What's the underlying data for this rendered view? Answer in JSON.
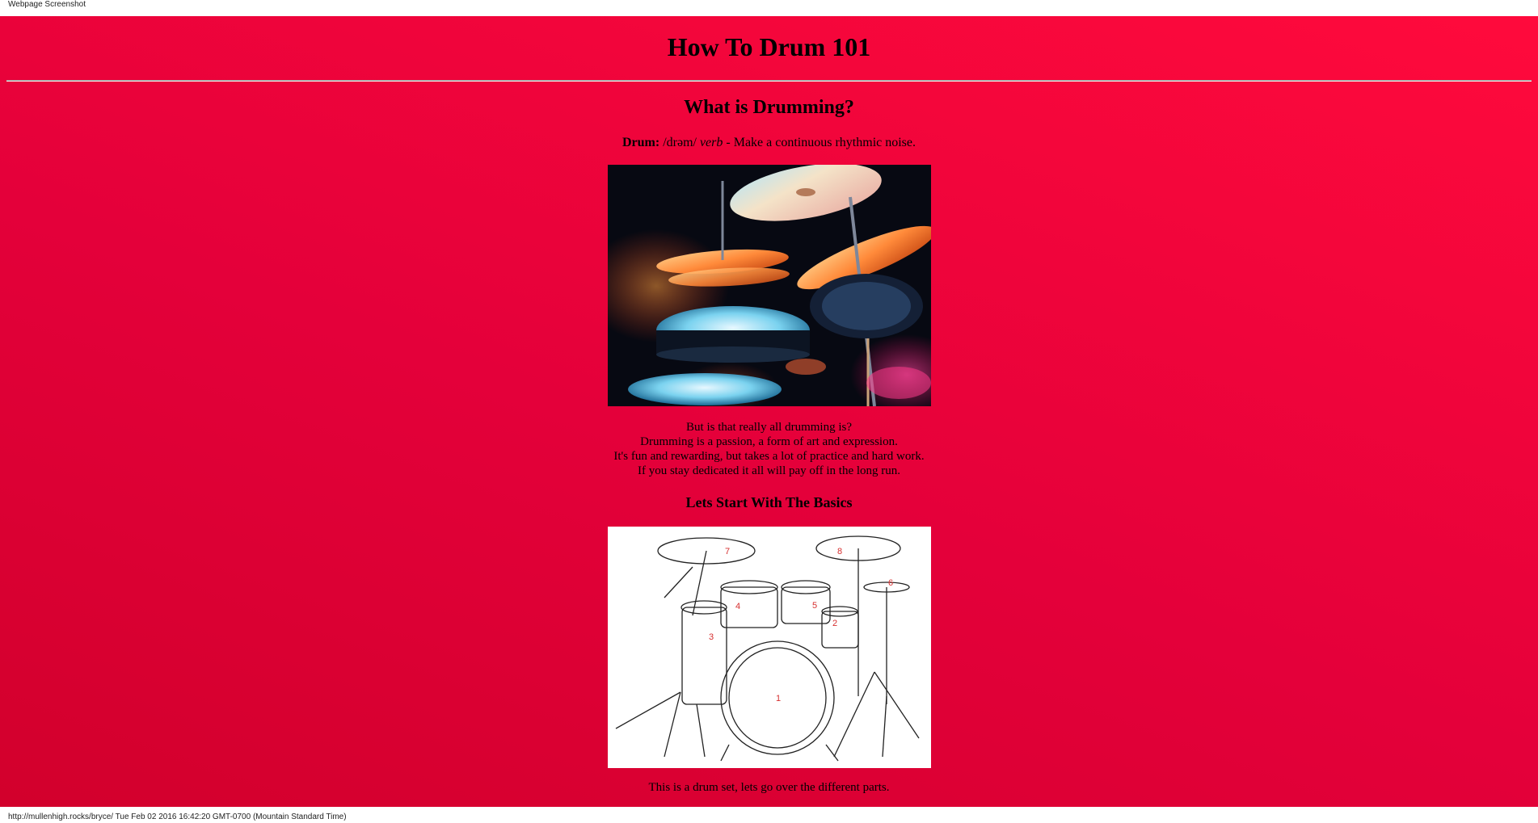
{
  "window": {
    "label": "Webpage Screenshot"
  },
  "header": {
    "title": "How To Drum 101"
  },
  "section": {
    "heading": "What is Drumming?",
    "definition": {
      "term": "Drum:",
      "pronunciation": "/drəm/",
      "part_of_speech": "verb",
      "meaning": " - Make a continuous rhythmic noise."
    },
    "paragraph_lines": [
      "But is that really all drumming is?",
      "Drumming is a passion, a form of art and expression.",
      "It's fun and rewarding, but takes a lot of practice and hard work.",
      "If you stay dedicated it all will pay off in the long run."
    ]
  },
  "basics": {
    "heading": "Lets Start With The Basics",
    "diagram_numbers": [
      "1",
      "2",
      "3",
      "4",
      "5",
      "6",
      "7",
      "8"
    ],
    "caption": "This is a drum set, lets go over the different parts."
  },
  "status": {
    "text": "http://mullenhigh.rocks/bryce/ Tue Feb 02 2016 16:42:20 GMT-0700 (Mountain Standard Time)"
  },
  "colors": {
    "background_start": "#d2002c",
    "background_end": "#ff0a3c",
    "diagram_label": "#d62f2f"
  }
}
